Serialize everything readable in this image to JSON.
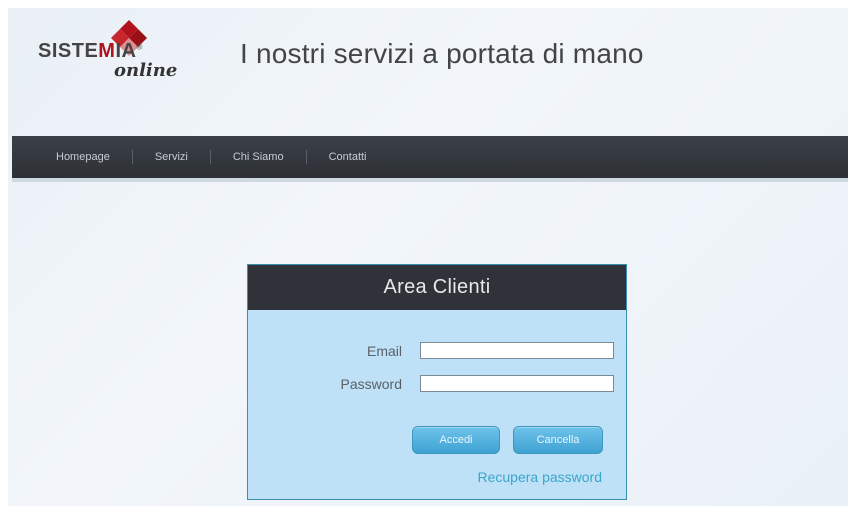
{
  "header": {
    "logo_word_left": "SISTE",
    "logo_word_mid": "M",
    "logo_word_right": "IA",
    "logo_registered": "®",
    "logo_sub": "online",
    "tagline": "I nostri servizi a portata di mano"
  },
  "nav": {
    "items": [
      {
        "label": "Homepage"
      },
      {
        "label": "Servizi"
      },
      {
        "label": "Chi Siamo"
      },
      {
        "label": "Contatti"
      }
    ]
  },
  "login": {
    "title": "Area Clienti",
    "email_label": "Email",
    "email_value": "",
    "password_label": "Password",
    "password_value": "",
    "accedi_label": "Accedi",
    "cancella_label": "Cancella",
    "recover_label": "Recupera password"
  },
  "colors": {
    "brand_red": "#b1121b",
    "nav_bg": "#2f3339",
    "login_bg": "#bfe1f7",
    "button_blue": "#3fa2d3",
    "link_blue": "#3aa6c8"
  },
  "icons": [
    "logo-diamond-icon"
  ]
}
